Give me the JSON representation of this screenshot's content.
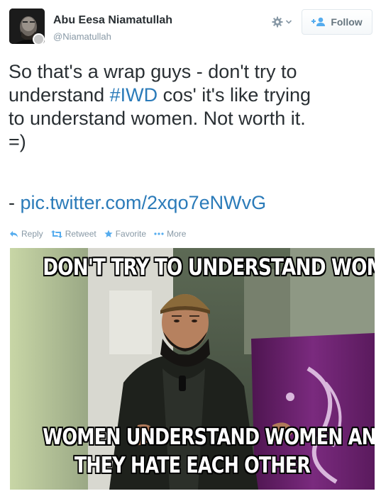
{
  "user": {
    "name": "Abu Eesa Niamatullah",
    "handle": "@Niamatullah"
  },
  "header": {
    "follow_label": "Follow",
    "gear_icon": "gear-icon",
    "follow_icon": "add-user-icon"
  },
  "tweet": {
    "line1": "So that's a wrap guys - don't try to",
    "line2_before": "understand ",
    "hashtag": "#IWD",
    "line2_after": " cos' it's like trying",
    "line3": "to understand women. Not worth it.",
    "line4": "=)",
    "pic_prefix": "- ",
    "pic_link": "pic.twitter.com/2xqo7eNWvG"
  },
  "actions": {
    "reply": "Reply",
    "retweet": "Retweet",
    "favorite": "Favorite",
    "more": "More"
  },
  "meme": {
    "top_caption": "DON'T TRY TO UNDERSTAND WOMEN",
    "bottom_caption_line1": "WOMEN UNDERSTAND WOMEN AND",
    "bottom_caption_line2": "THEY HATE EACH OTHER"
  },
  "colors": {
    "link": "#2b7bb9",
    "text": "#292f33",
    "muted": "#8899a6",
    "banner_purple": "#6b1f6f"
  }
}
